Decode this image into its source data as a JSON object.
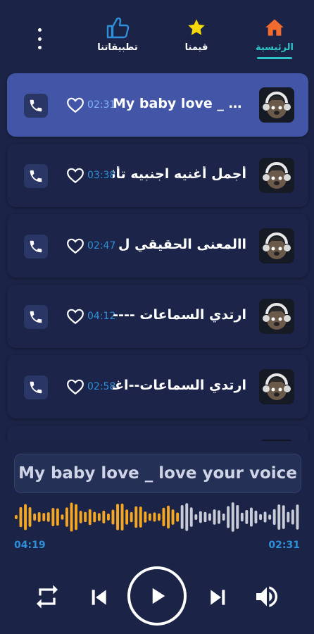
{
  "tabs": [
    {
      "label": "الرئيسية",
      "icon": "home-icon",
      "active": true
    },
    {
      "label": "قيمنا",
      "icon": "star-icon",
      "active": false
    },
    {
      "label": "تطبيقاتنا",
      "icon": "thumbs-up-icon",
      "active": false
    }
  ],
  "songs": [
    {
      "title": "My baby love _ love your voice",
      "duration": "02:31",
      "active": true
    },
    {
      "title": "أجمل أغنيه اجنبيه تأثر بالقلب",
      "duration": "03:38",
      "active": false
    },
    {
      "title": "االمعنى الحقيقي ل ترنيمة",
      "duration": "02:47",
      "active": false
    },
    {
      "title": "ارتدي السماعات ----",
      "duration": "04:12",
      "active": false
    },
    {
      "title": "ارتدي السماعات--اغنية",
      "duration": "02:58",
      "active": false
    }
  ],
  "player": {
    "now_playing": "My baby love _ love your voice",
    "current_time": "04:19",
    "duration": "02:31",
    "progress_fraction": 0.58
  },
  "colors": {
    "background": "#1b2447",
    "active_row": "#4355a6",
    "accent_teal": "#2ec4c7",
    "time_blue": "#2f8fd8",
    "wave_played": "#f5a623",
    "wave_remaining": "#c9ccd6"
  }
}
